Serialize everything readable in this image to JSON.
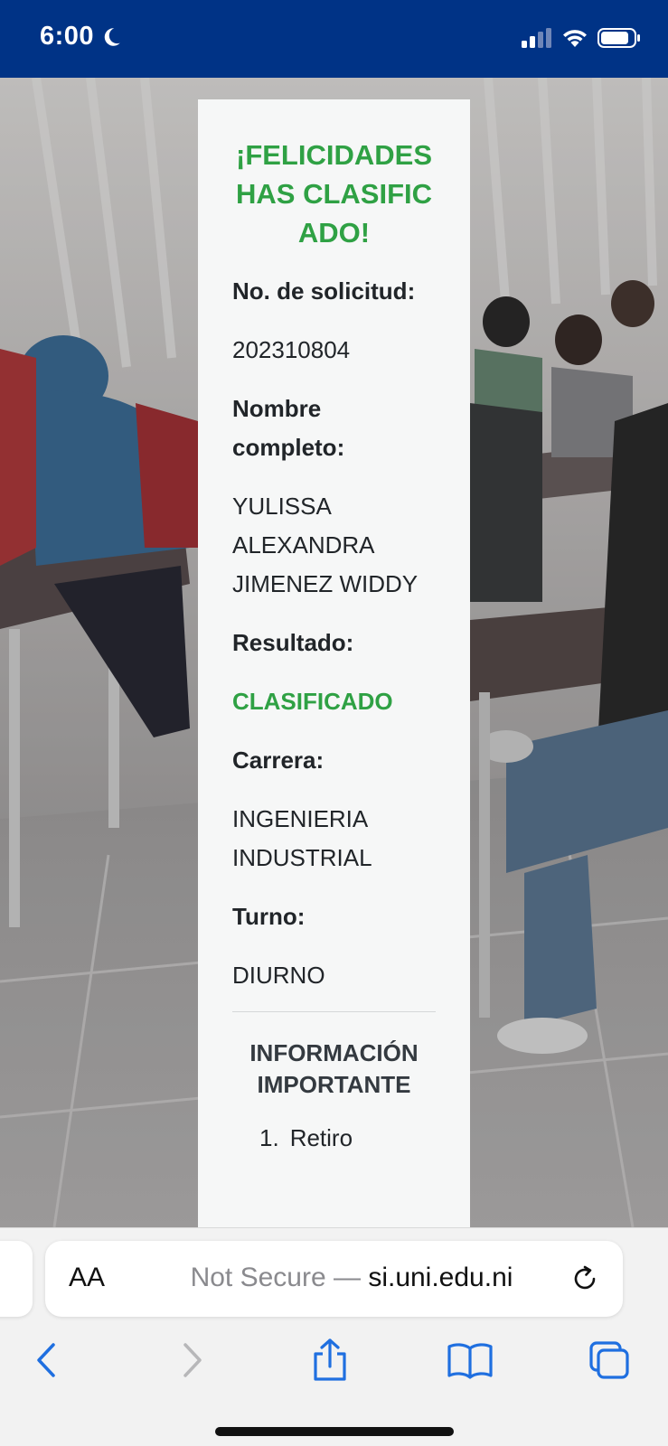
{
  "status_bar": {
    "time": "6:00",
    "background": "#003386"
  },
  "card": {
    "headline": "¡FELICIDADES HAS CLASIFICADO!",
    "fields": [
      {
        "label": "No. de solicitud:",
        "value": "202310804"
      },
      {
        "label": "Nombre completo:",
        "value": "YULISSA ALEXANDRA JIMENEZ WIDDY"
      },
      {
        "label": "Resultado:",
        "value": "CLASIFICADO"
      },
      {
        "label": "Carrera:",
        "value": "INGENIERIA INDUSTRIAL"
      },
      {
        "label": "Turno:",
        "value": "DIURNO"
      }
    ],
    "info_title": "INFORMACIÓN IMPORTANTE",
    "info_items": [
      {
        "number": "1.",
        "text": "Retiro"
      }
    ],
    "accent_color": "#2fa144"
  },
  "browser": {
    "aa_label": "AA",
    "url_prefix": "Not Secure — ",
    "url_domain": "si.uni.edu.ni"
  }
}
